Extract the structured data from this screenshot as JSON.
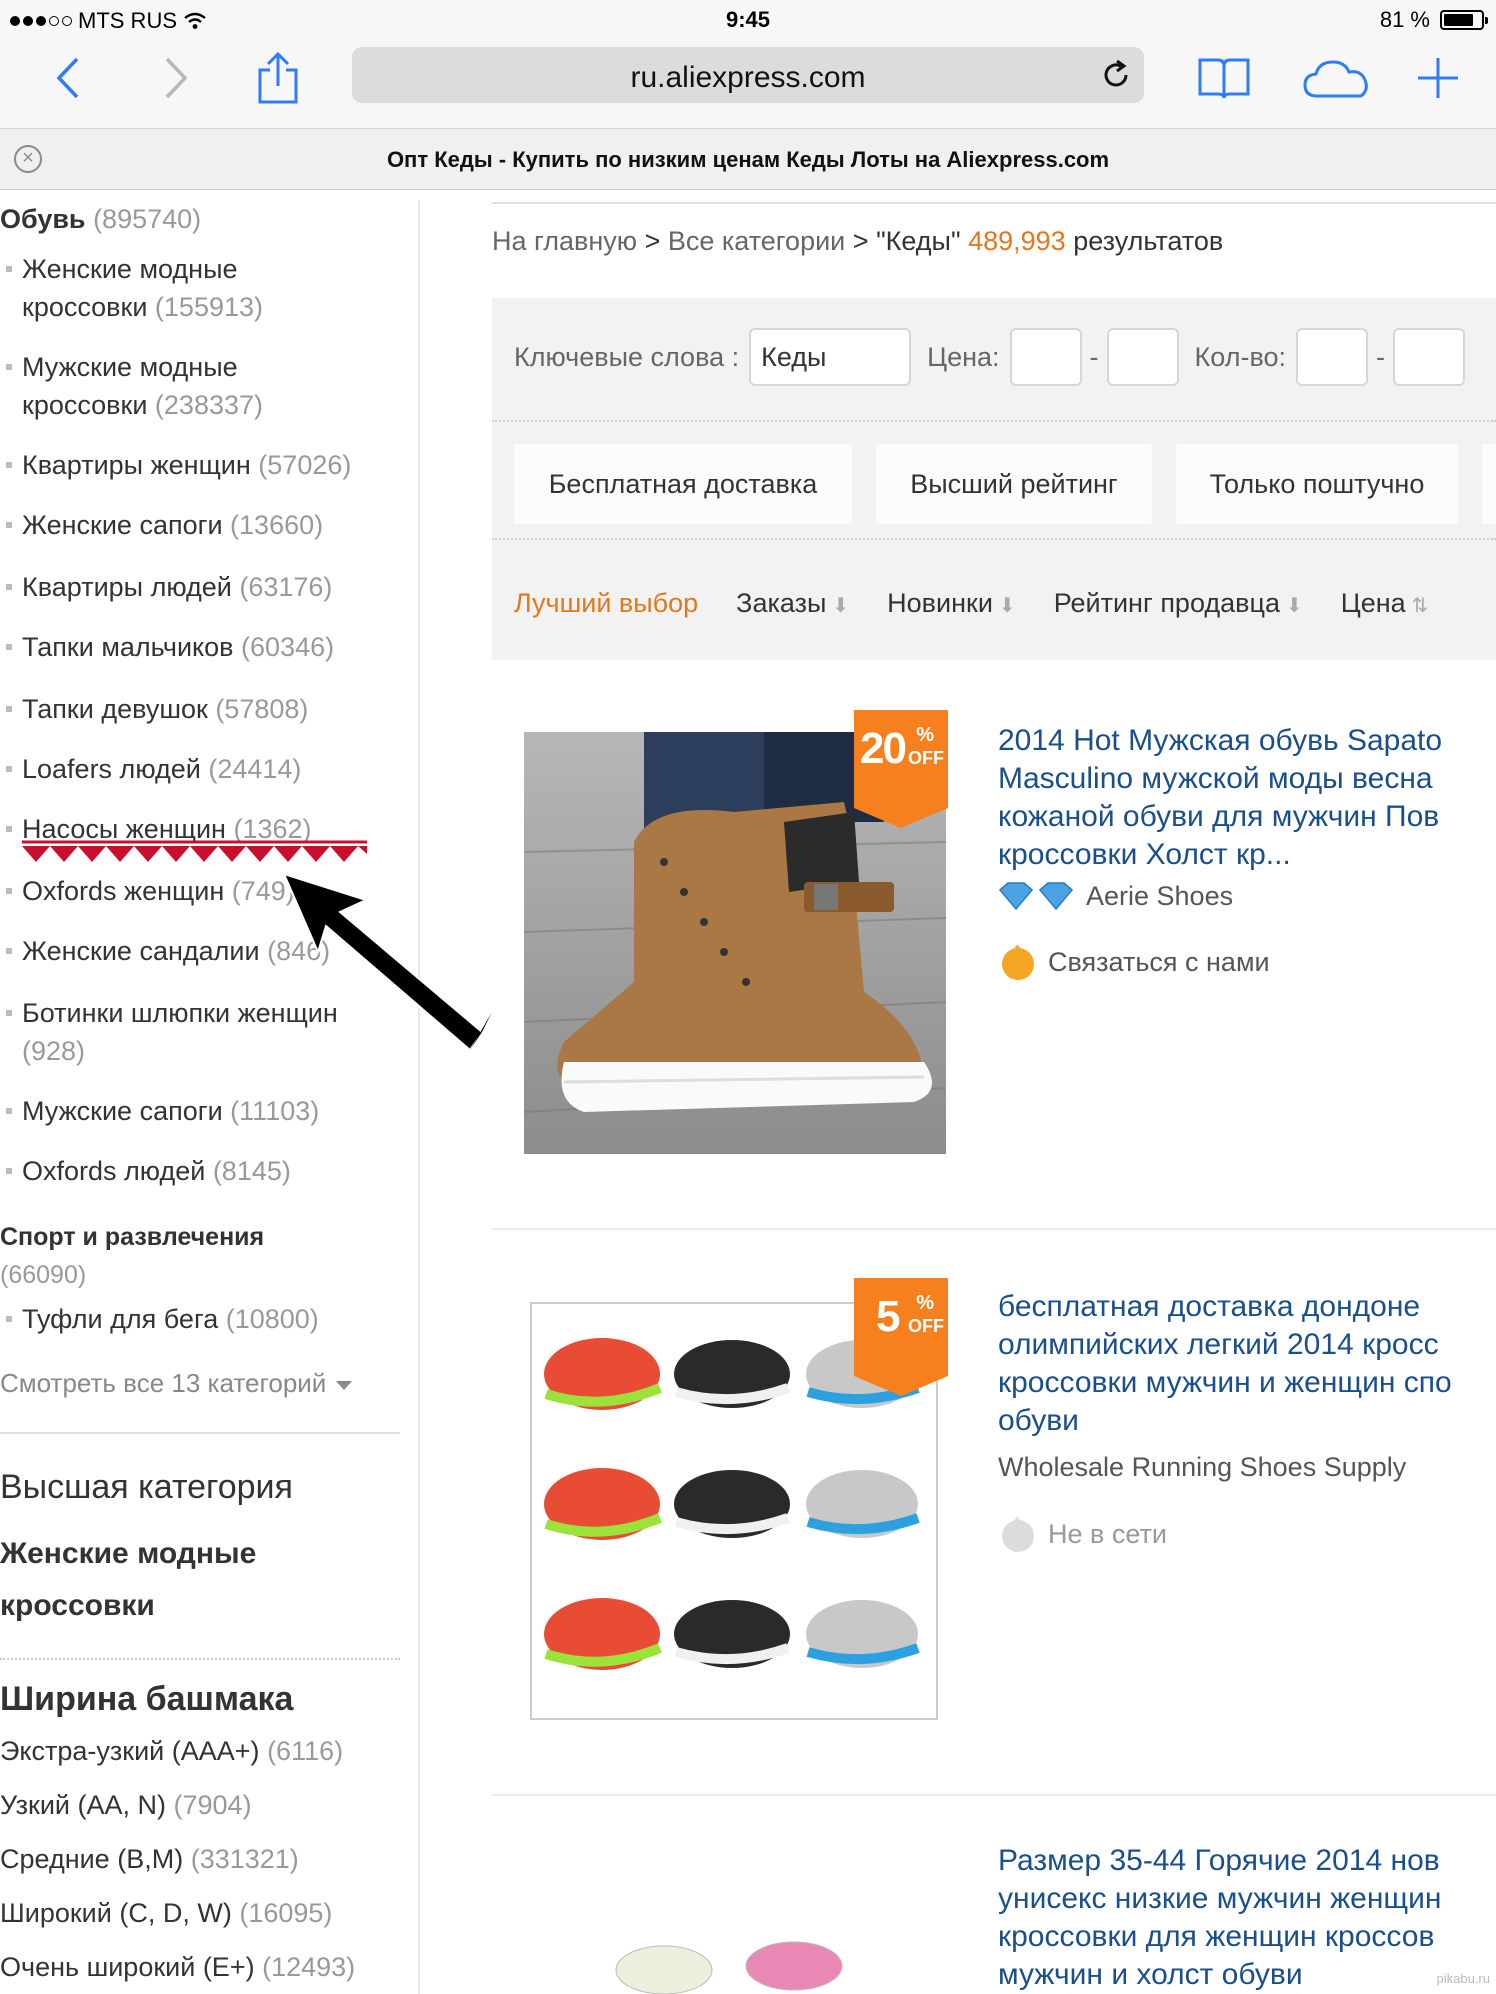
{
  "status_bar": {
    "carrier": "MTS RUS",
    "time": "9:45",
    "battery": "81 %",
    "battery_level": 0.81
  },
  "browser": {
    "url": "ru.aliexpress.com",
    "tab_title": "Опт Кеды - Купить по низким ценам Кеды Лоты на Aliexpress.com"
  },
  "sidebar": {
    "categories": [
      {
        "name": "Обувь",
        "count": "(895740)",
        "items": [
          {
            "label": "Женские модные",
            "label2": "кроссовки",
            "count": "(155913)"
          },
          {
            "label": "Мужские модные",
            "label2": "кроссовки",
            "count": "(238337)"
          },
          {
            "label": "Квартиры женщин",
            "count": "(57026)"
          },
          {
            "label": "Женские сапоги",
            "count": "(13660)"
          },
          {
            "label": "Квартиры людей",
            "count": "(63176)"
          },
          {
            "label": "Тапки мальчиков",
            "count": "(60346)"
          },
          {
            "label": "Тапки девушок",
            "count": "(57808)"
          },
          {
            "label": "Loafers людей",
            "count": "(24414)"
          },
          {
            "label": "Насосы женщин",
            "count": "(1362)"
          },
          {
            "label": "Oxfords женщин",
            "count": "(749)"
          },
          {
            "label": "Женские сандалии",
            "count": "(846)"
          },
          {
            "label": "Ботинки шлюпки женщин",
            "count": "(928)"
          },
          {
            "label": "Мужские сапоги",
            "count": "(11103)"
          },
          {
            "label": "Oxfords людей",
            "count": "(8145)"
          }
        ]
      },
      {
        "name": "Спорт и развлечения",
        "count": "(66090)",
        "items": [
          {
            "label": "Туфли для бега",
            "count": "(10800)"
          }
        ]
      }
    ],
    "see_all": "Смотреть все 13 категорий",
    "top_category_title": "Высшая категория",
    "top_category_value": "Женские модные кроссовки",
    "top_category_line1": "Женские модные",
    "top_category_line2": "кроссовки",
    "width_title": "Ширина башмака",
    "widths": [
      {
        "label": "Экстра-узкий (AAA+)",
        "count": "(6116)"
      },
      {
        "label": "Узкий (AA, N)",
        "count": "(7904)"
      },
      {
        "label": "Средние (B,M)",
        "count": "(331321)"
      },
      {
        "label": "Широкий (C, D, W)",
        "count": "(16095)"
      },
      {
        "label": "Очень широкий (E+)",
        "count": "(12493)"
      }
    ]
  },
  "main": {
    "breadcrumb": {
      "home": "На главную",
      "sep": ">",
      "all": "Все категории",
      "query": "\"Кеды\"",
      "count": "489,993",
      "suffix": "результатов"
    },
    "filters": {
      "keywords_label": "Ключевые слова :",
      "keywords_value": "Кеды",
      "price_label": "Цена:",
      "qty_label": "Кол-во:",
      "range_sep": "-",
      "chips": [
        "Бесплатная доставка",
        "Высший рейтинг",
        "Только поштучно"
      ]
    },
    "sort": [
      "Лучший выбор",
      "Заказы",
      "Новинки",
      "Рейтинг продавца",
      "Цена"
    ],
    "products": [
      {
        "discount": "20",
        "percent": "%",
        "off": "OFF",
        "title_lines": [
          "2014 Hot Мужская обувь Sapato",
          "Masculino мужской моды весна",
          "кожаной обуви для мужчин Пов",
          "кроссовки Холст кр..."
        ],
        "store": "Aerie Shoes",
        "contact": "Связаться с нами"
      },
      {
        "discount": "5",
        "percent": "%",
        "off": "OFF",
        "title_lines": [
          "бесплатная доставка дондоне",
          "олимпийских легкий 2014 кросс",
          "кроссовки мужчин и женщин спо",
          "обуви"
        ],
        "store": "Wholesale Running Shoes Supply",
        "contact": "Не в сети"
      },
      {
        "title_lines": [
          "Размер 35-44 Горячие 2014 нов",
          "унисекс низкие мужчин женщин",
          "кроссовки для женщин кроссов",
          "мужчин и холст обуви"
        ]
      }
    ]
  },
  "colors": {
    "accent": "#e4761c",
    "link": "#1a4f8b",
    "badge": "#f67f1e",
    "ios_blue": "#2f7cf6"
  },
  "watermark": "pikabu.ru"
}
